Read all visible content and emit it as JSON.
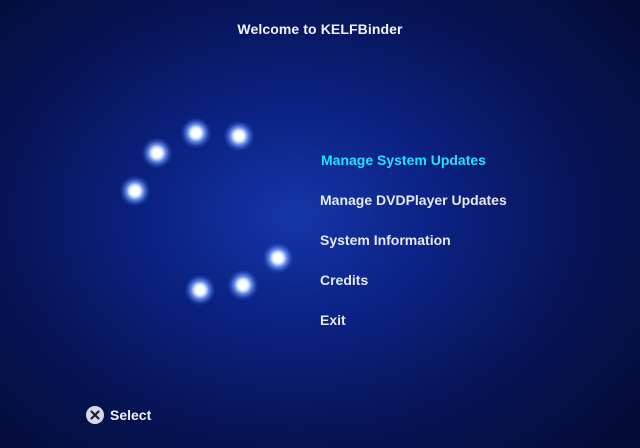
{
  "header": {
    "title": "Welcome to KELFBinder"
  },
  "loading_indicator": {
    "icon": "spinning-orbs"
  },
  "menu": {
    "items": [
      {
        "label": "Manage System Updates",
        "selected": true
      },
      {
        "label": "Manage DVDPlayer Updates",
        "selected": false
      },
      {
        "label": "System Information",
        "selected": false
      },
      {
        "label": "Credits",
        "selected": false
      },
      {
        "label": "Exit",
        "selected": false
      }
    ],
    "selected_color": "#26e0ff",
    "default_color": "#e4e8f2"
  },
  "footer": {
    "select_hint": {
      "icon": "cross-button-icon",
      "label": "Select"
    }
  }
}
